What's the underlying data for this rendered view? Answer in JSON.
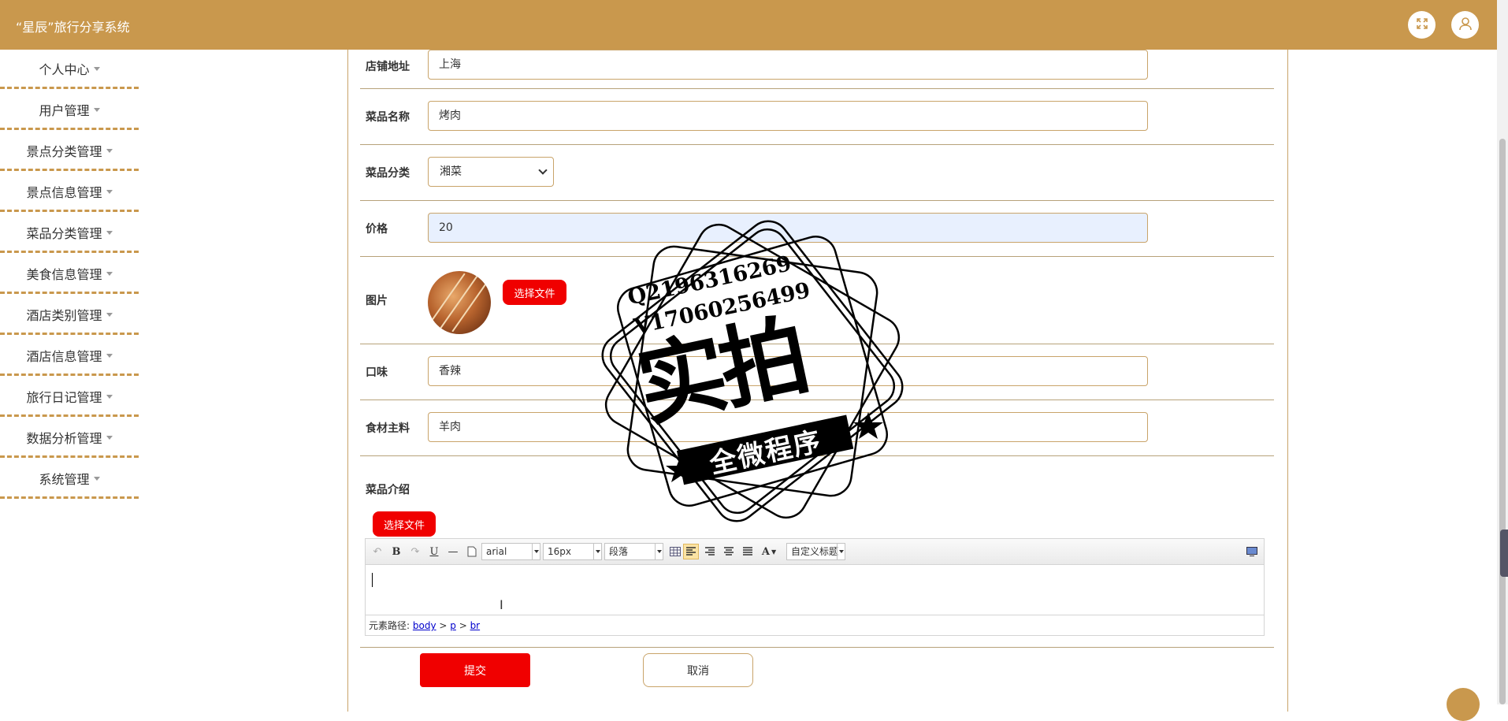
{
  "app": {
    "title": "“星辰”旅行分享系统"
  },
  "sidebar": {
    "items": [
      {
        "label": "个人中心"
      },
      {
        "label": "用户管理"
      },
      {
        "label": "景点分类管理"
      },
      {
        "label": "景点信息管理"
      },
      {
        "label": "菜品分类管理"
      },
      {
        "label": "美食信息管理"
      },
      {
        "label": "酒店类别管理"
      },
      {
        "label": "酒店信息管理"
      },
      {
        "label": "旅行日记管理"
      },
      {
        "label": "数据分析管理"
      },
      {
        "label": "系统管理"
      }
    ]
  },
  "form": {
    "shop_address": {
      "label": "店铺地址",
      "value": "上海"
    },
    "dish_name": {
      "label": "菜品名称",
      "value": "烤肉"
    },
    "dish_category": {
      "label": "菜品分类",
      "value": "湘菜"
    },
    "price": {
      "label": "价格",
      "value": "20"
    },
    "image": {
      "label": "图片",
      "button": "选择文件"
    },
    "taste": {
      "label": "口味",
      "value": "香辣"
    },
    "ingredient": {
      "label": "食材主料",
      "value": "羊肉"
    },
    "intro": {
      "label": "菜品介绍",
      "button": "选择文件"
    }
  },
  "editor": {
    "font_family": "arial",
    "font_size": "16px",
    "paragraph": "段落",
    "custom_title": "自定义标题",
    "path_label": "元素路径:",
    "path": [
      "body",
      "p",
      "br"
    ],
    "bold": "B",
    "underline": "U",
    "font_color": "A"
  },
  "actions": {
    "submit": "提交",
    "cancel": "取消"
  },
  "watermark": {
    "line1": "Q2196316269",
    "line2": "V17060256499",
    "big": "实拍",
    "ribbon": "全微程序"
  },
  "colors": {
    "brand": "#c9984d",
    "primary_button": "#f00000"
  }
}
